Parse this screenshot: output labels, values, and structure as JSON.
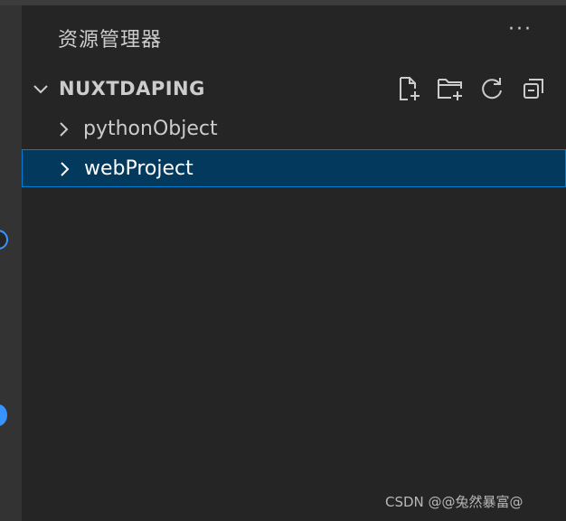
{
  "explorer": {
    "title": "资源管理器",
    "more_label": "···"
  },
  "section": {
    "name": "NUXTDAPING",
    "expanded": true,
    "actions": [
      {
        "icon": "new-file-icon"
      },
      {
        "icon": "new-folder-icon"
      },
      {
        "icon": "refresh-icon"
      },
      {
        "icon": "collapse-all-icon"
      }
    ]
  },
  "tree": [
    {
      "label": "pythonObject",
      "selected": false
    },
    {
      "label": "webProject",
      "selected": true
    }
  ],
  "watermark": "CSDN @@兔然暴富@",
  "colors": {
    "sidebar_bg": "#252526",
    "activity_bg": "#333333",
    "selection_bg": "#04395e",
    "selection_border": "#007fd4",
    "accent": "#3794ff"
  }
}
